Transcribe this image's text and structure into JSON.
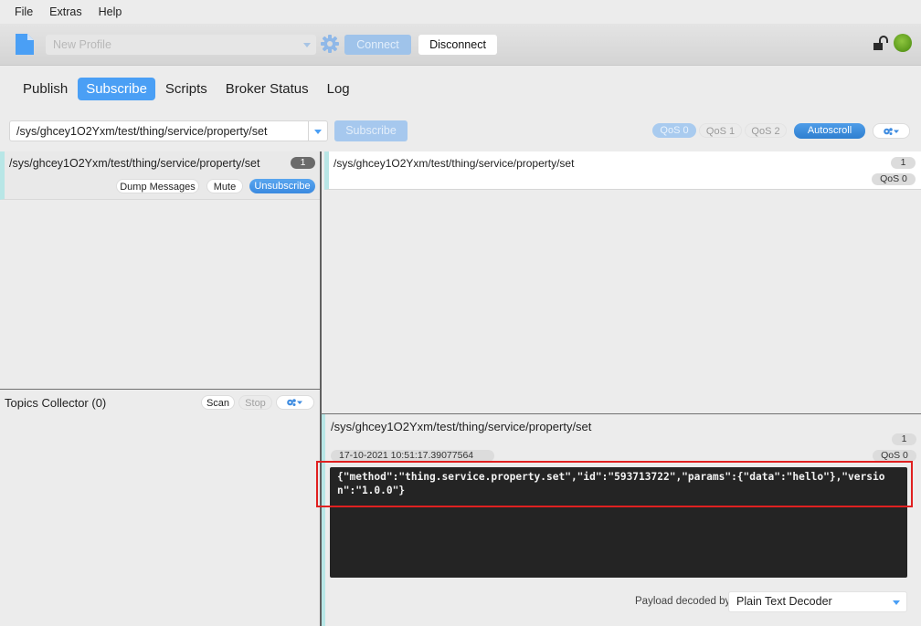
{
  "menu": {
    "items": [
      "File",
      "Extras",
      "Help"
    ]
  },
  "toolbar": {
    "profile_placeholder": "New Profile",
    "connect_label": "Connect",
    "disconnect_label": "Disconnect",
    "connection_status": "connected",
    "status_color": "#6aa82a"
  },
  "tabs": [
    {
      "label": "Publish",
      "active": false
    },
    {
      "label": "Subscribe",
      "active": true
    },
    {
      "label": "Scripts",
      "active": false
    },
    {
      "label": "Broker Status",
      "active": false
    },
    {
      "label": "Log",
      "active": false
    }
  ],
  "subscribe_bar": {
    "topic_value": "/sys/ghcey1O2Yxm/test/thing/service/property/set",
    "subscribe_label": "Subscribe",
    "qos_options": [
      "QoS 0",
      "QoS 1",
      "QoS 2"
    ],
    "qos_selected": "QoS 0",
    "autoscroll_label": "Autoscroll"
  },
  "subscriptions": [
    {
      "topic": "/sys/ghcey1O2Yxm/test/thing/service/property/set",
      "count": "1",
      "dump_label": "Dump Messages",
      "mute_label": "Mute",
      "unsubscribe_label": "Unsubscribe"
    }
  ],
  "topics_collector": {
    "title": "Topics Collector (0)",
    "scan_label": "Scan",
    "stop_label": "Stop"
  },
  "messages": [
    {
      "topic": "/sys/ghcey1O2Yxm/test/thing/service/property/set",
      "number": "1",
      "qos": "QoS 0"
    }
  ],
  "detail": {
    "topic": "/sys/ghcey1O2Yxm/test/thing/service/property/set",
    "number": "1",
    "timestamp": "17-10-2021  10:51:17.39077564",
    "qos": "QoS 0",
    "payload": "{\"method\":\"thing.service.property.set\",\"id\":\"593713722\",\"params\":{\"data\":\"hello\"},\"version\":\"1.0.0\"}",
    "decoder_label": "Payload decoded by",
    "decoder_value": "Plain Text Decoder"
  },
  "colors": {
    "accent": "#4a9ff5",
    "highlight": "#e02020"
  }
}
